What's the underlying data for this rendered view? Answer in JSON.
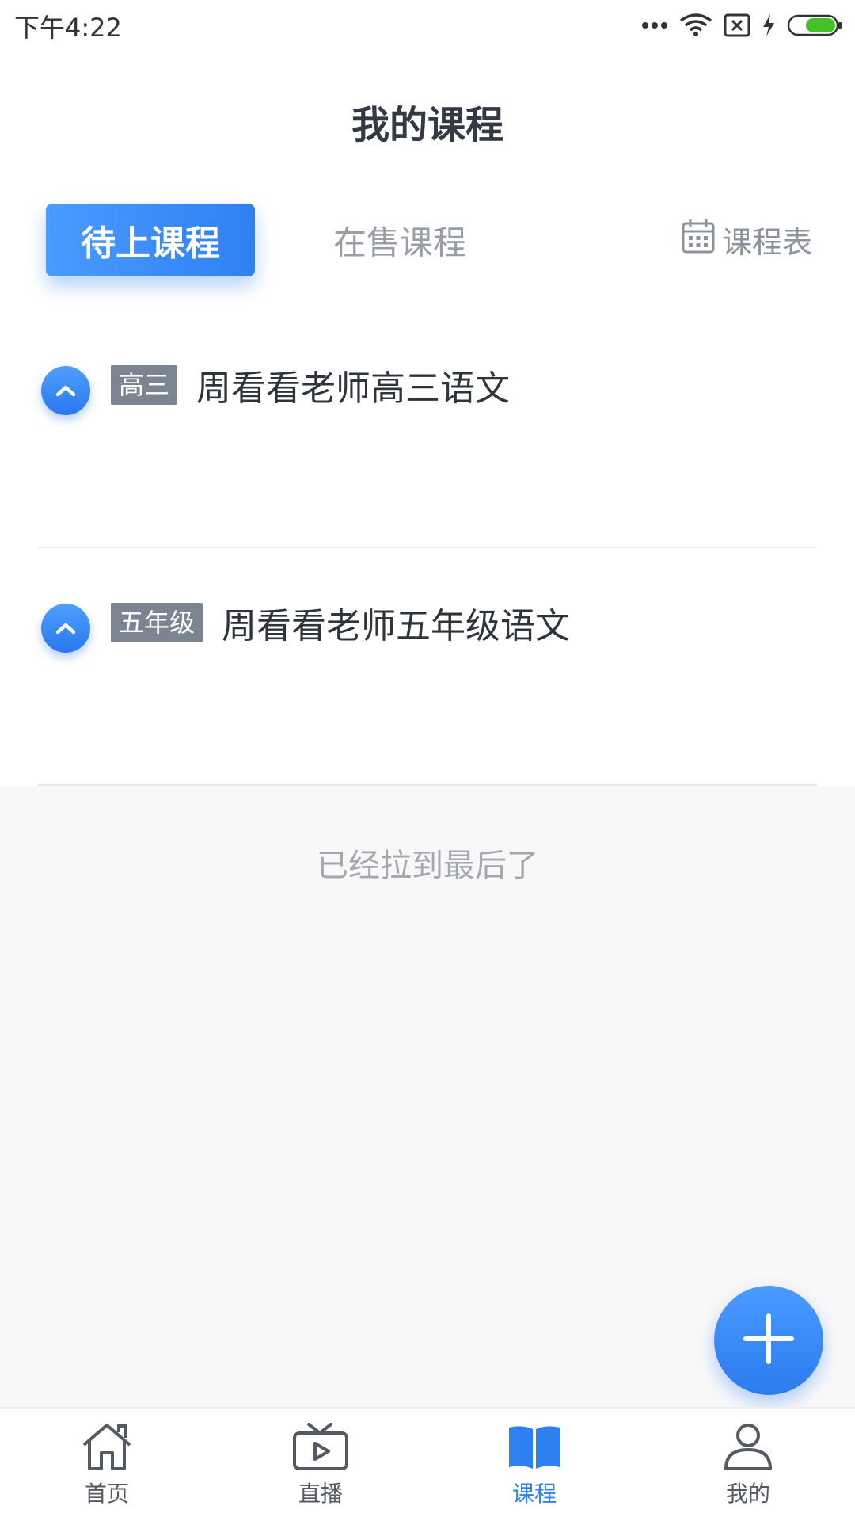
{
  "status_bar": {
    "time": "下午4:22",
    "icons": [
      "more-dots-icon",
      "wifi-icon",
      "no-sim-icon",
      "charging-icon",
      "battery-icon"
    ]
  },
  "header": {
    "title": "我的课程",
    "tabs": [
      {
        "label": "待上课程",
        "active": true
      },
      {
        "label": "在售课程",
        "active": false
      }
    ],
    "schedule": {
      "label": "课程表",
      "icon": "calendar-icon"
    }
  },
  "courses": [
    {
      "grade": "高三",
      "title": "周看看老师高三语文",
      "icon": "chevron-up-icon"
    },
    {
      "grade": "五年级",
      "title": "周看看老师五年级语文",
      "icon": "chevron-up-icon"
    }
  ],
  "list_end_text": "已经拉到最后了",
  "fab": {
    "icon": "plus-icon"
  },
  "bottom_nav": [
    {
      "label": "首页",
      "icon": "home-icon",
      "active": false
    },
    {
      "label": "直播",
      "icon": "tv-icon",
      "active": false
    },
    {
      "label": "课程",
      "icon": "book-icon",
      "active": true
    },
    {
      "label": "我的",
      "icon": "user-icon",
      "active": false
    }
  ],
  "colors": {
    "accent": "#2f80f3",
    "badge": "#7b8491",
    "text_muted": "#9a9ea6"
  }
}
